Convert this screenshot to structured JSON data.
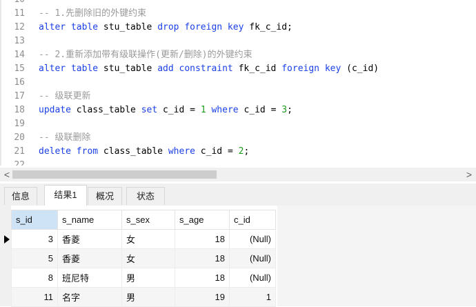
{
  "editor": {
    "lines": [
      {
        "no": "10",
        "tokens": []
      },
      {
        "no": "11",
        "tokens": [
          {
            "t": "-- 1.先删除旧的外键约束",
            "c": "comment"
          }
        ]
      },
      {
        "no": "12",
        "tokens": [
          {
            "t": "alter table",
            "c": "kw"
          },
          {
            "t": " stu_table ",
            "c": "id"
          },
          {
            "t": "drop foreign key",
            "c": "kw"
          },
          {
            "t": " fk_c_id;",
            "c": "id"
          }
        ]
      },
      {
        "no": "13",
        "tokens": []
      },
      {
        "no": "14",
        "tokens": [
          {
            "t": "-- 2.重新添加带有级联操作(更新/删除)的外键约束",
            "c": "comment"
          }
        ]
      },
      {
        "no": "15",
        "tokens": [
          {
            "t": "alter table",
            "c": "kw"
          },
          {
            "t": " stu_table ",
            "c": "id"
          },
          {
            "t": "add constraint",
            "c": "kw"
          },
          {
            "t": " fk_c_id ",
            "c": "id"
          },
          {
            "t": "foreign key",
            "c": "kw"
          },
          {
            "t": " (c_id) ",
            "c": "id"
          }
        ]
      },
      {
        "no": "16",
        "tokens": []
      },
      {
        "no": "17",
        "tokens": [
          {
            "t": "-- 级联更新",
            "c": "comment"
          }
        ]
      },
      {
        "no": "18",
        "tokens": [
          {
            "t": "update",
            "c": "kw"
          },
          {
            "t": " class_table ",
            "c": "id"
          },
          {
            "t": "set",
            "c": "kw"
          },
          {
            "t": " c_id = ",
            "c": "id"
          },
          {
            "t": "1",
            "c": "num"
          },
          {
            "t": " ",
            "c": "id"
          },
          {
            "t": "where",
            "c": "kw"
          },
          {
            "t": " c_id = ",
            "c": "id"
          },
          {
            "t": "3",
            "c": "num"
          },
          {
            "t": ";",
            "c": "id"
          }
        ]
      },
      {
        "no": "19",
        "tokens": []
      },
      {
        "no": "20",
        "tokens": [
          {
            "t": "-- 级联删除",
            "c": "comment"
          }
        ]
      },
      {
        "no": "21",
        "tokens": [
          {
            "t": "delete from",
            "c": "kw"
          },
          {
            "t": " class_table ",
            "c": "id"
          },
          {
            "t": "where",
            "c": "kw"
          },
          {
            "t": " c_id = ",
            "c": "id"
          },
          {
            "t": "2",
            "c": "num"
          },
          {
            "t": ";",
            "c": "id"
          }
        ]
      },
      {
        "no": "22",
        "tokens": []
      }
    ]
  },
  "scrollbar": {
    "left_arrow": "<",
    "right_arrow": ">"
  },
  "tabs": [
    {
      "label": "信息",
      "active": false
    },
    {
      "label": "结果1",
      "active": true
    },
    {
      "label": "概况",
      "active": false
    },
    {
      "label": "状态",
      "active": false
    }
  ],
  "result": {
    "columns": [
      "s_id",
      "s_name",
      "s_sex",
      "s_age",
      "c_id"
    ],
    "rows": [
      [
        "3",
        "香菱",
        "女",
        "18",
        "(Null)"
      ],
      [
        "5",
        "香菱",
        "女",
        "18",
        "(Null)"
      ],
      [
        "8",
        "班尼特",
        "男",
        "18",
        "(Null)"
      ],
      [
        "11",
        "名字",
        "男",
        "19",
        "1"
      ]
    ]
  }
}
